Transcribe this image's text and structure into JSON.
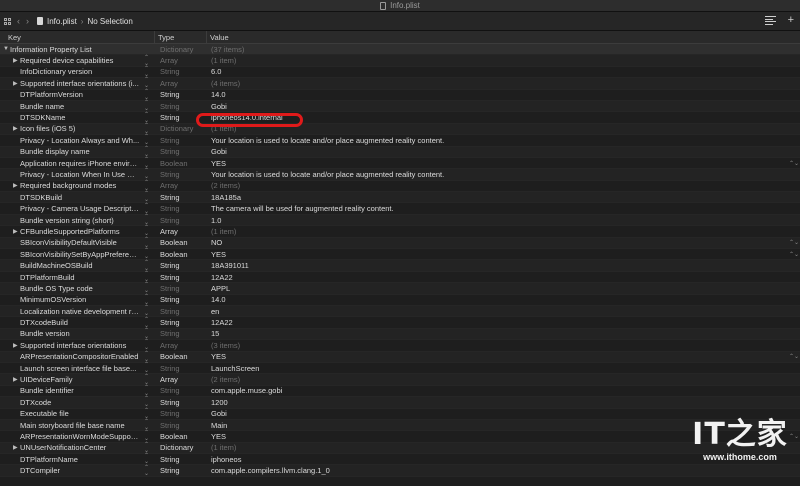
{
  "window": {
    "title": "Info.plist"
  },
  "toolbar": {
    "file": "Info.plist",
    "selection": "No Selection"
  },
  "columns": {
    "key": "Key",
    "type": "Type",
    "value": "Value"
  },
  "rows": [
    {
      "key": "Information Property List",
      "type": "Dictionary",
      "value": "(37 items)",
      "disc": "▼",
      "root": true,
      "dimType": true,
      "dimValue": true
    },
    {
      "key": "Required device capabilities",
      "type": "Array",
      "value": "(1 item)",
      "disc": "▶",
      "dimType": true,
      "dimValue": true
    },
    {
      "key": "InfoDictionary version",
      "type": "String",
      "value": "6.0",
      "dimType": true
    },
    {
      "key": "Supported interface orientations (i...",
      "type": "Array",
      "value": "(4 items)",
      "disc": "▶",
      "dimType": true,
      "dimValue": true
    },
    {
      "key": "DTPlatformVersion",
      "type": "String",
      "value": "14.0"
    },
    {
      "key": "Bundle name",
      "type": "String",
      "value": "Gobi",
      "dimType": true
    },
    {
      "key": "DTSDKName",
      "type": "String",
      "value": "iphoneos14.0.internal"
    },
    {
      "key": "Icon files (iOS 5)",
      "type": "Dictionary",
      "value": "(1 item)",
      "disc": "▶",
      "dimType": true,
      "dimValue": true
    },
    {
      "key": "Privacy - Location Always and Wh...",
      "type": "String",
      "value": "Your location is used to locate and/or place augmented reality content.",
      "dimType": true
    },
    {
      "key": "Bundle display name",
      "type": "String",
      "value": "Gobi",
      "dimType": true
    },
    {
      "key": "Application requires iPhone enviro...",
      "type": "Boolean",
      "value": "YES",
      "dimType": true,
      "rstep": true
    },
    {
      "key": "Privacy - Location When In Use Us...",
      "type": "String",
      "value": "Your location is used to locate and/or place augmented reality content.",
      "dimType": true
    },
    {
      "key": "Required background modes",
      "type": "Array",
      "value": "(2 items)",
      "disc": "▶",
      "dimType": true,
      "dimValue": true
    },
    {
      "key": "DTSDKBuild",
      "type": "String",
      "value": "18A185a"
    },
    {
      "key": "Privacy - Camera Usage Description",
      "type": "String",
      "value": "The camera will be used for augmented reality content.",
      "dimType": true
    },
    {
      "key": "Bundle version string (short)",
      "type": "String",
      "value": "1.0",
      "dimType": true
    },
    {
      "key": "CFBundleSupportedPlatforms",
      "type": "Array",
      "value": "(1 item)",
      "disc": "▶",
      "dimValue": true
    },
    {
      "key": "SBIconVisibilityDefaultVisible",
      "type": "Boolean",
      "value": "NO",
      "rstep": true
    },
    {
      "key": "SBIconVisibilitySetByAppPreference",
      "type": "Boolean",
      "value": "YES",
      "rstep": true
    },
    {
      "key": "BuildMachineOSBuild",
      "type": "String",
      "value": "18A391011"
    },
    {
      "key": "DTPlatformBuild",
      "type": "String",
      "value": "12A22"
    },
    {
      "key": "Bundle OS Type code",
      "type": "String",
      "value": "APPL",
      "dimType": true
    },
    {
      "key": "MinimumOSVersion",
      "type": "String",
      "value": "14.0"
    },
    {
      "key": "Localization native development re...",
      "type": "String",
      "value": "en",
      "dimType": true
    },
    {
      "key": "DTXcodeBuild",
      "type": "String",
      "value": "12A22"
    },
    {
      "key": "Bundle version",
      "type": "String",
      "value": "15",
      "dimType": true
    },
    {
      "key": "Supported interface orientations",
      "type": "Array",
      "value": "(3 items)",
      "disc": "▶",
      "dimType": true,
      "dimValue": true
    },
    {
      "key": "ARPresentationCompositorEnabled",
      "type": "Boolean",
      "value": "YES",
      "rstep": true
    },
    {
      "key": "Launch screen interface file base...",
      "type": "String",
      "value": "LaunchScreen",
      "dimType": true
    },
    {
      "key": "UIDeviceFamily",
      "type": "Array",
      "value": "(2 items)",
      "disc": "▶",
      "dimValue": true
    },
    {
      "key": "Bundle identifier",
      "type": "String",
      "value": "com.apple.muse.gobi",
      "dimType": true
    },
    {
      "key": "DTXcode",
      "type": "String",
      "value": "1200"
    },
    {
      "key": "Executable file",
      "type": "String",
      "value": "Gobi",
      "dimType": true
    },
    {
      "key": "Main storyboard file base name",
      "type": "String",
      "value": "Main",
      "dimType": true
    },
    {
      "key": "ARPresentationWornModeSupport...",
      "type": "Boolean",
      "value": "YES",
      "rstep": true
    },
    {
      "key": "UNUserNotificationCenter",
      "type": "Dictionary",
      "value": "(1 item)",
      "disc": "▶",
      "dimValue": true
    },
    {
      "key": "DTPlatformName",
      "type": "String",
      "value": "iphoneos"
    },
    {
      "key": "DTCompiler",
      "type": "String",
      "value": "com.apple.compilers.llvm.clang.1_0"
    }
  ],
  "watermark": {
    "logo": "IT之家",
    "url": "www.ithome.com"
  },
  "colors": {
    "highlight": "#e01a1a",
    "background": "#1e1e1e"
  }
}
